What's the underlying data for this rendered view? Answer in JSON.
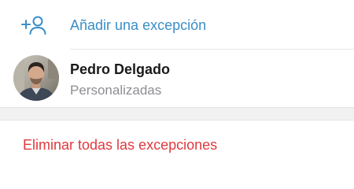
{
  "add_exception": {
    "label": "Añadir una excepción",
    "icon": "add-user-icon",
    "color": "#3a8ec7"
  },
  "exceptions": [
    {
      "name": "Pedro Delgado",
      "subtitle": "Personalizadas",
      "avatar": "user-photo"
    }
  ],
  "delete_all": {
    "label": "Eliminar todas las excepciones",
    "color": "#e0393e"
  }
}
